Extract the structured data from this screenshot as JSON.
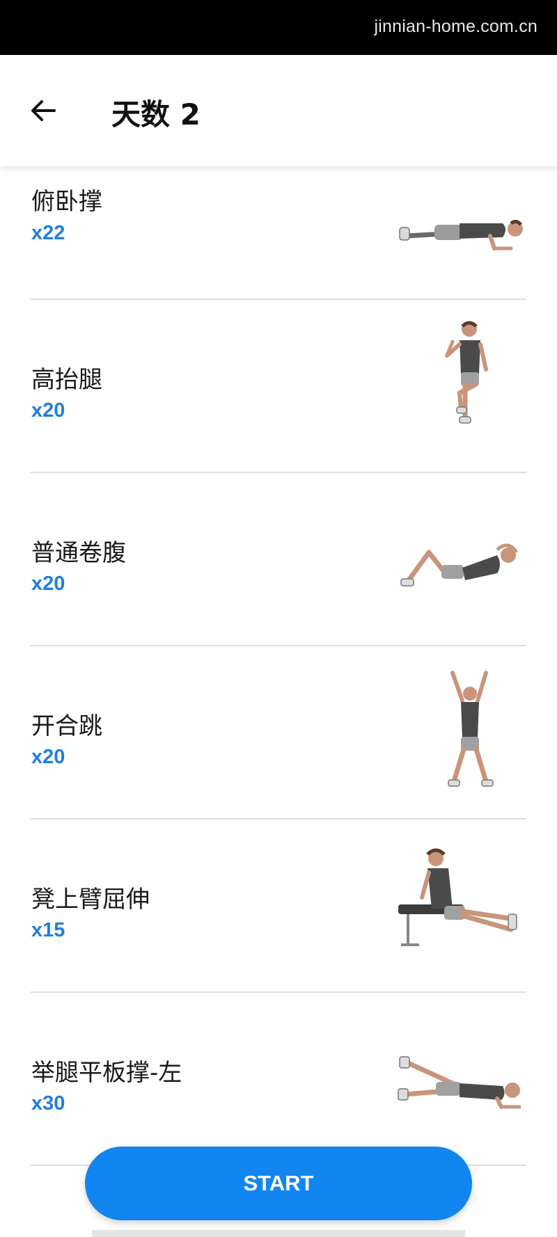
{
  "watermark": "jinnian-home.com.cn",
  "header": {
    "back_icon": "arrow-left-icon",
    "title": "天数 2"
  },
  "exercises": [
    {
      "name": "俯卧撑",
      "reps": "x22",
      "icon": "push-up-figure"
    },
    {
      "name": "高抬腿",
      "reps": "x20",
      "icon": "high-knees-figure"
    },
    {
      "name": "普通卷腹",
      "reps": "x20",
      "icon": "crunch-figure"
    },
    {
      "name": "开合跳",
      "reps": "x20",
      "icon": "jumping-jack-figure"
    },
    {
      "name": "凳上臂屈伸",
      "reps": "x15",
      "icon": "bench-dip-figure"
    },
    {
      "name": "举腿平板撑-左",
      "reps": "x30",
      "icon": "leg-raise-plank-figure"
    }
  ],
  "start_button": {
    "label": "START"
  },
  "colors": {
    "accent": "#1286f0",
    "reps_text": "#1f7fdb",
    "status_bar": "#000000",
    "divider": "#dedede"
  }
}
